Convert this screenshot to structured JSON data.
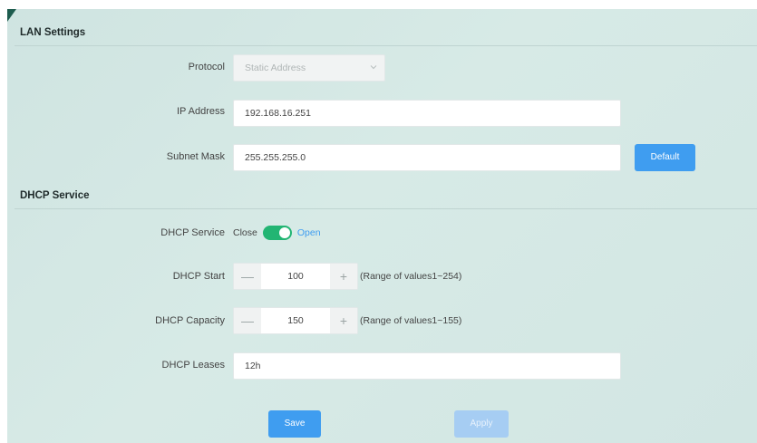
{
  "lan": {
    "title": "LAN Settings",
    "protocol_label": "Protocol",
    "protocol_value": "Static Address",
    "ip_label": "IP Address",
    "ip_value": "192.168.16.251",
    "mask_label": "Subnet Mask",
    "mask_value": "255.255.255.0",
    "default_label": "Default"
  },
  "dhcp": {
    "title": "DHCP Service",
    "service_label": "DHCP Service",
    "close_label": "Close",
    "open_label": "Open",
    "enabled": true,
    "start_label": "DHCP Start",
    "start_value": "100",
    "start_hint": "(Range of values1~254)",
    "capacity_label": "DHCP Capacity",
    "capacity_value": "150",
    "capacity_hint": "(Range of values1~155)",
    "leases_label": "DHCP Leases",
    "leases_value": "12h",
    "minus_glyph": "—",
    "plus_glyph": "+"
  },
  "actions": {
    "save_label": "Save",
    "apply_label": "Apply"
  },
  "colors": {
    "accent_blue": "#3f9df0",
    "toggle_green": "#22b573",
    "corner": "#1d5c4e"
  }
}
